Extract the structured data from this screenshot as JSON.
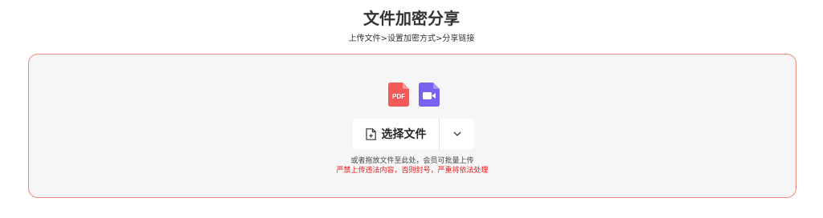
{
  "header": {
    "title": "文件加密分享",
    "steps": "上传文件>设置加密方式>分享链接"
  },
  "upload": {
    "file_icons": [
      {
        "name": "pdf-file-icon",
        "label": "PDF",
        "color": "#f25a5a"
      },
      {
        "name": "video-file-icon",
        "label": "",
        "color": "#7b61f0"
      }
    ],
    "select_button_label": "选择文件",
    "dropdown_icon": "chevron-down-icon",
    "hint": "或者拖放文件至此处，会员可批量上传",
    "warning": "严禁上传违法内容，否则封号，严重将依法处理"
  },
  "colors": {
    "border_accent": "#f28a7c",
    "dropzone_bg": "#f6f6f6",
    "warning": "#ee1c1c",
    "pdf": "#f25a5a",
    "video": "#7b61f0"
  }
}
